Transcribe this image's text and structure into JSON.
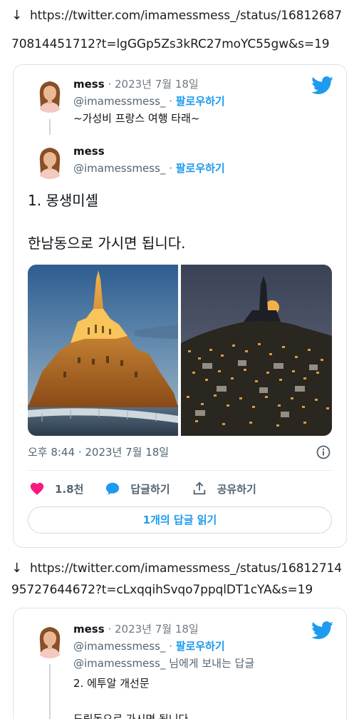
{
  "links": [
    {
      "arrow": "↓",
      "line1": "https://twitter.com/imamessmess_/status/16812687",
      "line2": "70814451712?t=lgGGp5Zs3kRC27moYC55gw&s=19"
    },
    {
      "arrow": "↓",
      "line1": "https://twitter.com/imamessmess_/status/16812714",
      "line2": "95727644672?t=cLxqqihSvqo7ppqlDT1cYA&s=19"
    }
  ],
  "card1": {
    "parent": {
      "name": "mess",
      "separator": " · ",
      "date": "2023년 7월 18일",
      "handle": "@imamessmess_",
      "follow_sep": " · ",
      "follow": "팔로우하기",
      "text": "~가성비 프랑스 여행 타래~"
    },
    "main": {
      "name": "mess",
      "handle": "@imamessmess_",
      "follow_sep": " · ",
      "follow": "팔로우하기",
      "text_line1": "1. 몽생미셸",
      "text_line2": "한남동으로 가시면 됩니다."
    },
    "timestamp": "오후 8:44 · 2023년 7월 18일",
    "likes": "1.8천",
    "reply_label": "답글하기",
    "share_label": "공유하기",
    "read_replies": "1개의 답글 읽기"
  },
  "card2": {
    "name": "mess",
    "separator": " · ",
    "date": "2023년 7월 18일",
    "handle": "@imamessmess_",
    "follow_sep": " · ",
    "follow": "팔로우하기",
    "reply_to": "@imamessmess_ 님에게 보내는 답글",
    "text_line1": "2. 에투알 개선문",
    "text_line2": "도림동으로 가시면 됩니다"
  },
  "colors": {
    "twitter_blue": "#1d9bf0",
    "like_pink": "#f91880",
    "muted": "#536471"
  }
}
